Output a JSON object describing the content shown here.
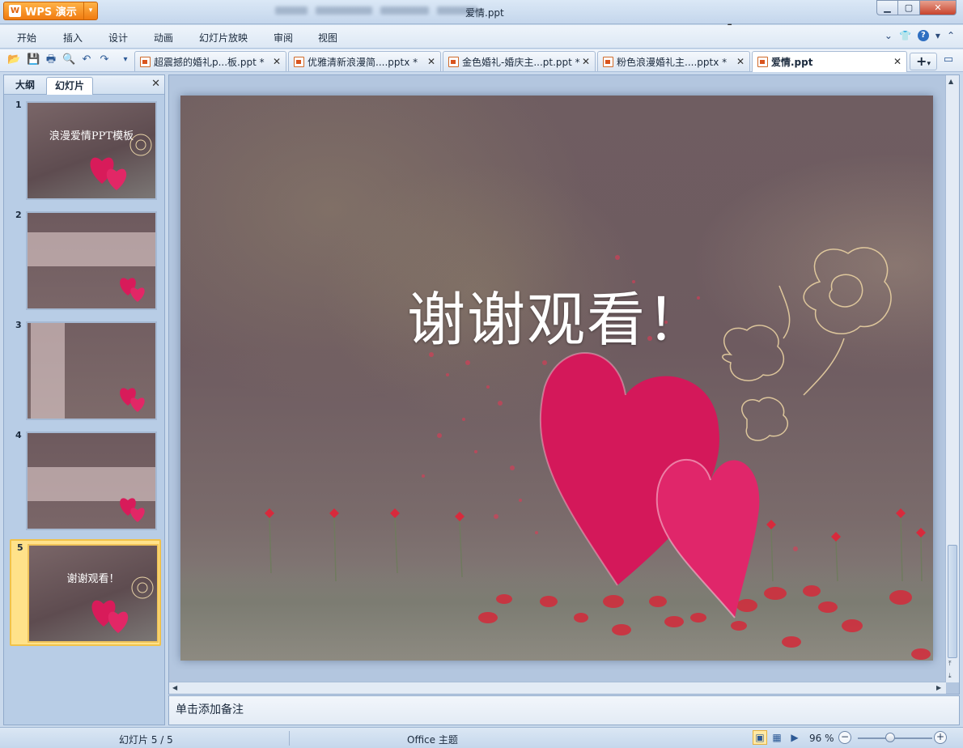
{
  "app": {
    "button_label": "WPS 演示",
    "window_title": "爱情.ppt"
  },
  "menu": {
    "items": [
      "开始",
      "插入",
      "设计",
      "动画",
      "幻灯片放映",
      "审阅",
      "视图"
    ]
  },
  "tabs": [
    {
      "label": "超震撼的婚礼p...板.ppt *"
    },
    {
      "label": "优雅清新浪漫简....pptx *"
    },
    {
      "label": "金色婚礼-婚庆主...pt.ppt *"
    },
    {
      "label": "粉色浪漫婚礼主....pptx *"
    },
    {
      "label": "爱情.ppt",
      "active": true
    }
  ],
  "left_panel": {
    "tabs": [
      "大纲",
      "幻灯片"
    ],
    "active_tab": "幻灯片",
    "slides": [
      {
        "num": "1",
        "title": "浪漫爱情PPT模板"
      },
      {
        "num": "2",
        "title": ""
      },
      {
        "num": "3",
        "title": ""
      },
      {
        "num": "4",
        "title": ""
      },
      {
        "num": "5",
        "title": "谢谢观看！",
        "selected": true
      }
    ]
  },
  "slide": {
    "title": "谢谢观看！"
  },
  "notes": {
    "placeholder": "单击添加备注"
  },
  "status": {
    "slide_indicator": "幻灯片 5 / 5",
    "theme": "Office 主题",
    "zoom": "96 %"
  },
  "colors": {
    "accent": "#f07b10",
    "heart": "#d81b5a",
    "selection": "#ffe28a"
  }
}
